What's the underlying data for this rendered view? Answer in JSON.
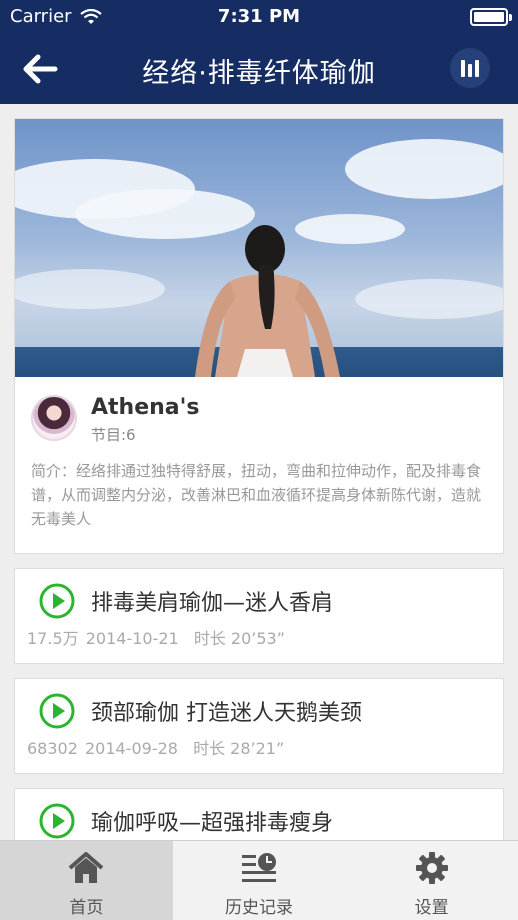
{
  "status_bar": {
    "carrier": "Carrier",
    "time": "7:31 PM"
  },
  "nav": {
    "title": "经络·排毒纤体瑜伽"
  },
  "author": {
    "name": "Athena's",
    "count": "节目:6",
    "description": "简介：经络排通过独特得舒展，扭动，弯曲和拉伸动作，配及排毒食谱，从而调整内分泌，改善淋巴和血液循环提高身体新陈代谢，造就无毒美人"
  },
  "episodes": [
    {
      "title": "排毒美肩瑜伽—迷人香肩",
      "plays": "17.5万",
      "date": "2014-10-21",
      "duration": "时长 20’53”"
    },
    {
      "title": "颈部瑜伽 打造迷人天鹅美颈",
      "plays": "68302",
      "date": "2014-09-28",
      "duration": "时长 28’21”"
    },
    {
      "title": "瑜伽呼吸—超强排毒瘦身",
      "plays": "",
      "date": "",
      "duration": ""
    }
  ],
  "tabs": [
    {
      "label": "首页",
      "icon": "home-icon"
    },
    {
      "label": "历史记录",
      "icon": "history-icon"
    },
    {
      "label": "设置",
      "icon": "gear-icon"
    }
  ],
  "colors": {
    "navbar": "#162d63",
    "play_green": "#2bb42f",
    "tab_active": "#d6d6d6"
  }
}
